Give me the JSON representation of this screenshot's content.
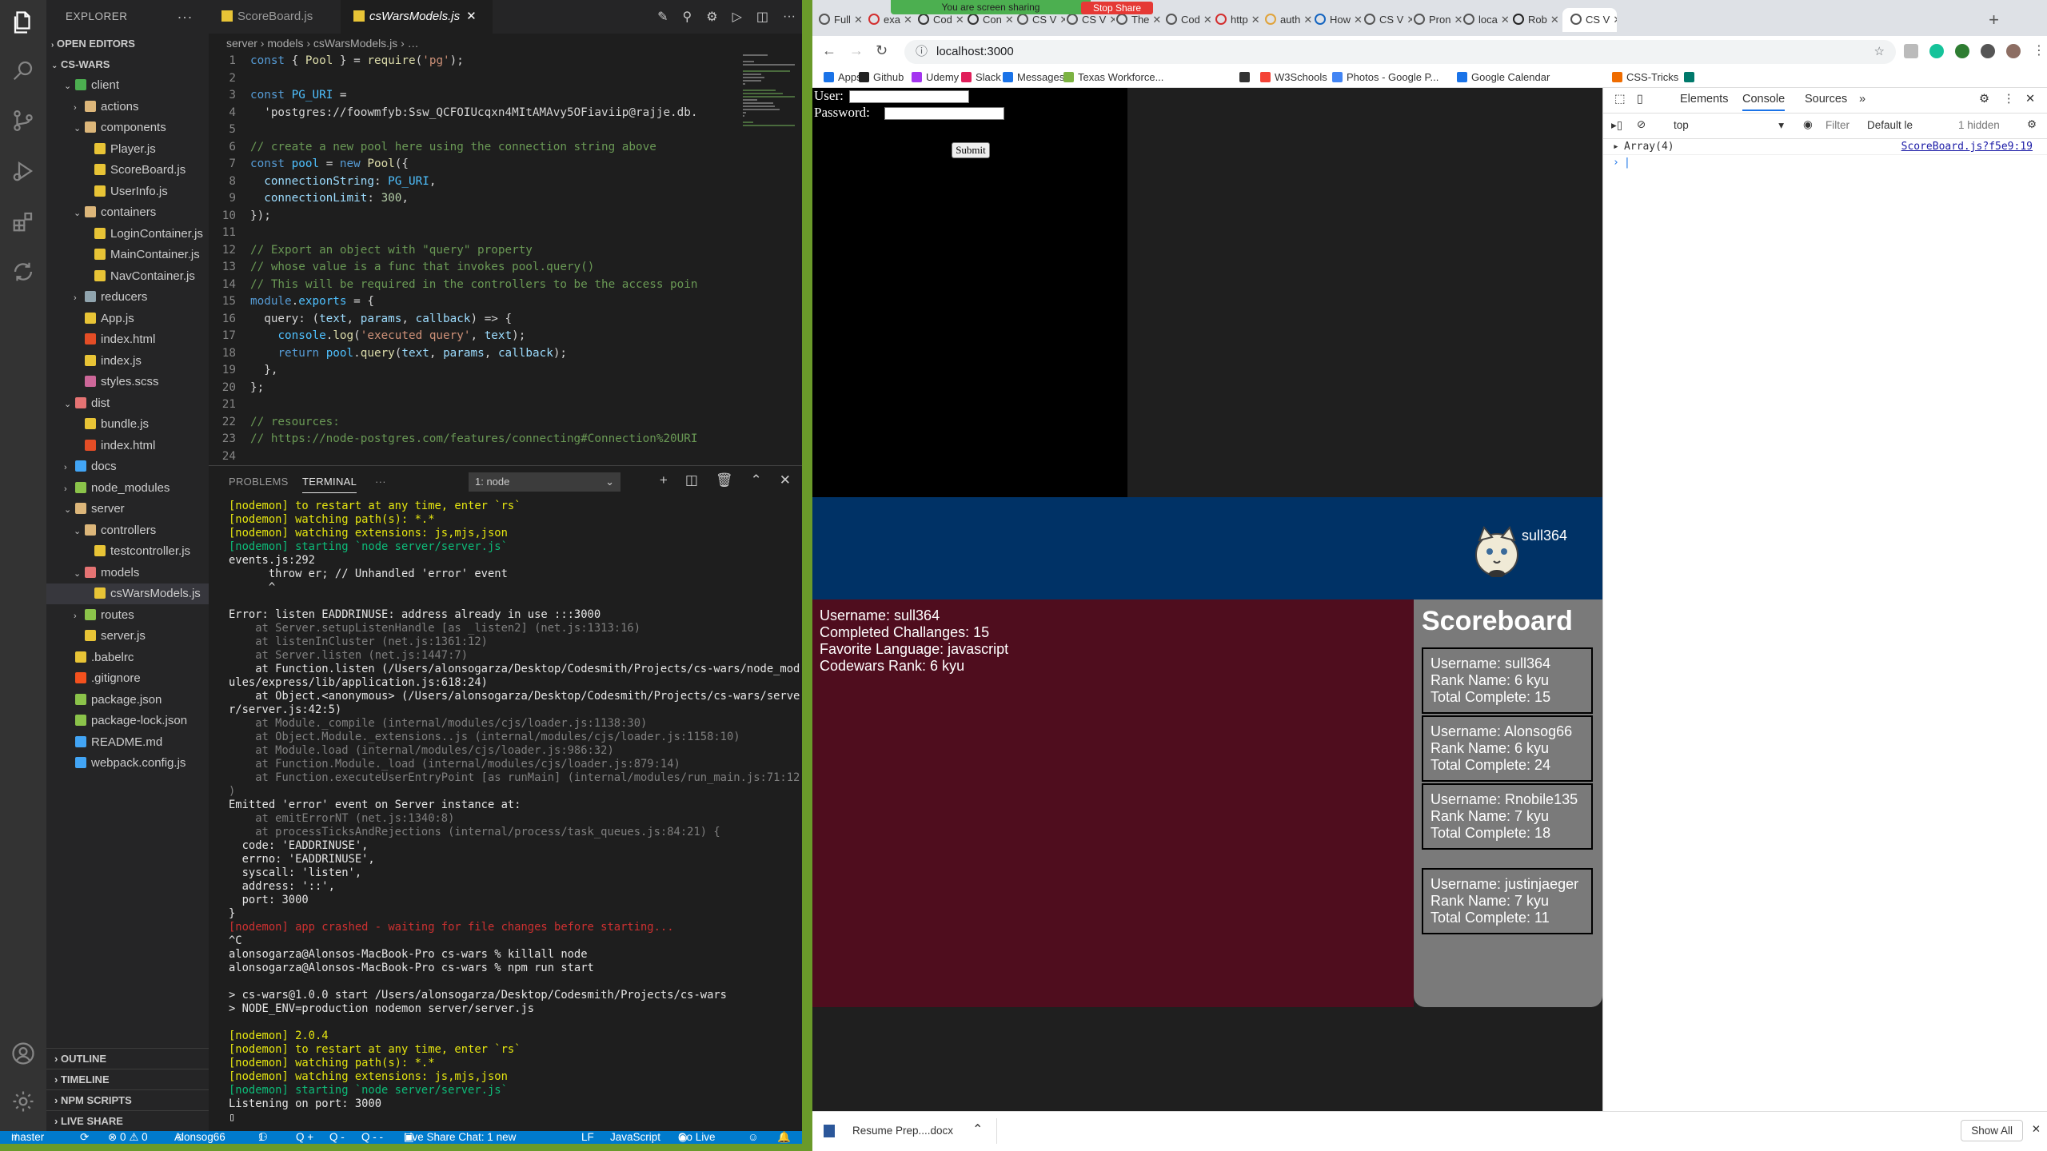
{
  "vscode": {
    "explorer_title": "EXPLORER",
    "open_editors": "OPEN EDITORS",
    "project": "CS-WARS",
    "tree": [
      {
        "label": "client",
        "depth": 1,
        "kind": "folder-open",
        "color": "#4caf50"
      },
      {
        "label": "actions",
        "depth": 2,
        "kind": "folder",
        "color": "#dcb67a"
      },
      {
        "label": "components",
        "depth": 2,
        "kind": "folder-open",
        "color": "#dcb67a"
      },
      {
        "label": "Player.js",
        "depth": 3,
        "kind": "js",
        "color": "#e8c436"
      },
      {
        "label": "ScoreBoard.js",
        "depth": 3,
        "kind": "js",
        "color": "#e8c436"
      },
      {
        "label": "UserInfo.js",
        "depth": 3,
        "kind": "js",
        "color": "#e8c436"
      },
      {
        "label": "containers",
        "depth": 2,
        "kind": "folder-open",
        "color": "#dcb67a"
      },
      {
        "label": "LoginContainer.js",
        "depth": 3,
        "kind": "js",
        "color": "#e8c436"
      },
      {
        "label": "MainContainer.js",
        "depth": 3,
        "kind": "js",
        "color": "#e8c436"
      },
      {
        "label": "NavContainer.js",
        "depth": 3,
        "kind": "js",
        "color": "#e8c436"
      },
      {
        "label": "reducers",
        "depth": 2,
        "kind": "folder",
        "color": "#90a4ae"
      },
      {
        "label": "App.js",
        "depth": 2,
        "kind": "js",
        "color": "#e8c436"
      },
      {
        "label": "index.html",
        "depth": 2,
        "kind": "html",
        "color": "#e44d26"
      },
      {
        "label": "index.js",
        "depth": 2,
        "kind": "js",
        "color": "#e8c436"
      },
      {
        "label": "styles.scss",
        "depth": 2,
        "kind": "scss",
        "color": "#cd6799"
      },
      {
        "label": "dist",
        "depth": 1,
        "kind": "folder-open",
        "color": "#e57373"
      },
      {
        "label": "bundle.js",
        "depth": 2,
        "kind": "js",
        "color": "#e8c436"
      },
      {
        "label": "index.html",
        "depth": 2,
        "kind": "html",
        "color": "#e44d26"
      },
      {
        "label": "docs",
        "depth": 1,
        "kind": "folder",
        "color": "#42a5f5"
      },
      {
        "label": "node_modules",
        "depth": 1,
        "kind": "folder",
        "color": "#8bc34a"
      },
      {
        "label": "server",
        "depth": 1,
        "kind": "folder-open",
        "color": "#dcb67a"
      },
      {
        "label": "controllers",
        "depth": 2,
        "kind": "folder-open",
        "color": "#dcb67a"
      },
      {
        "label": "testcontroller.js",
        "depth": 3,
        "kind": "js",
        "color": "#e8c436"
      },
      {
        "label": "models",
        "depth": 2,
        "kind": "folder-open",
        "color": "#e57373"
      },
      {
        "label": "csWarsModels.js",
        "depth": 3,
        "kind": "js",
        "color": "#e8c436",
        "selected": true
      },
      {
        "label": "routes",
        "depth": 2,
        "kind": "folder",
        "color": "#8bc34a"
      },
      {
        "label": "server.js",
        "depth": 2,
        "kind": "js",
        "color": "#e8c436"
      },
      {
        "label": ".babelrc",
        "depth": 1,
        "kind": "js",
        "color": "#e8c436"
      },
      {
        "label": ".gitignore",
        "depth": 1,
        "kind": "git",
        "color": "#f4511e"
      },
      {
        "label": "package.json",
        "depth": 1,
        "kind": "json",
        "color": "#8bc34a"
      },
      {
        "label": "package-lock.json",
        "depth": 1,
        "kind": "json",
        "color": "#8bc34a"
      },
      {
        "label": "README.md",
        "depth": 1,
        "kind": "info",
        "color": "#42a5f5"
      },
      {
        "label": "webpack.config.js",
        "depth": 1,
        "kind": "webpack",
        "color": "#42a5f5"
      }
    ],
    "bottom_sections": [
      "OUTLINE",
      "TIMELINE",
      "NPM SCRIPTS",
      "LIVE SHARE"
    ],
    "tabs": [
      {
        "label": "ScoreBoard.js",
        "active": false
      },
      {
        "label": "csWarsModels.js",
        "active": true
      }
    ],
    "breadcrumb": "server  ›  models  ›  csWarsModels.js  ›  …",
    "code": [
      "const { Pool } = require('pg');",
      "",
      "const PG_URI =",
      "  'postgres://foowmfyb:Ssw_QCFOIUcqxn4MItAMAvy5OFiaviip@rajje.db.",
      "",
      "// create a new pool here using the connection string above",
      "const pool = new Pool({",
      "  connectionString: PG_URI,",
      "  connectionLimit: 300,",
      "});",
      "",
      "// Export an object with \"query\" property",
      "// whose value is a func that invokes pool.query()",
      "// This will be required in the controllers to be the access poin",
      "module.exports = {",
      "  query: (text, params, callback) => {",
      "    console.log('executed query', text);",
      "    return pool.query(text, params, callback);",
      "  },",
      "};",
      "",
      "// resources:",
      "// https://node-postgres.com/features/connecting#Connection%20URI",
      ""
    ],
    "panel": {
      "problems": "PROBLEMS",
      "terminal": "TERMINAL",
      "more": "···",
      "terminal_select": "1: node"
    },
    "terminal": [
      {
        "t": "[nodemon] to restart at any time, enter `rs`",
        "c": "yel"
      },
      {
        "t": "[nodemon] watching path(s): *.*",
        "c": "yel"
      },
      {
        "t": "[nodemon] watching extensions: js,mjs,json",
        "c": "yel"
      },
      {
        "t": "[nodemon] starting `node server/server.js`",
        "c": "grn"
      },
      {
        "t": "events.js:292",
        "c": "wht"
      },
      {
        "t": "      throw er; // Unhandled 'error' event",
        "c": "wht"
      },
      {
        "t": "      ^",
        "c": "wht"
      },
      {
        "t": "",
        "c": "wht"
      },
      {
        "t": "Error: listen EADDRINUSE: address already in use :::3000",
        "c": "wht"
      },
      {
        "t": "    at Server.setupListenHandle [as _listen2] (net.js:1313:16)",
        "c": "gry"
      },
      {
        "t": "    at listenInCluster (net.js:1361:12)",
        "c": "gry"
      },
      {
        "t": "    at Server.listen (net.js:1447:7)",
        "c": "gry"
      },
      {
        "t": "    at Function.listen (/Users/alonsogarza/Desktop/Codesmith/Projects/cs-wars/node_mod",
        "c": "wht"
      },
      {
        "t": "ules/express/lib/application.js:618:24)",
        "c": "wht"
      },
      {
        "t": "    at Object.<anonymous> (/Users/alonsogarza/Desktop/Codesmith/Projects/cs-wars/serve",
        "c": "wht"
      },
      {
        "t": "r/server.js:42:5)",
        "c": "wht"
      },
      {
        "t": "    at Module._compile (internal/modules/cjs/loader.js:1138:30)",
        "c": "gry"
      },
      {
        "t": "    at Object.Module._extensions..js (internal/modules/cjs/loader.js:1158:10)",
        "c": "gry"
      },
      {
        "t": "    at Module.load (internal/modules/cjs/loader.js:986:32)",
        "c": "gry"
      },
      {
        "t": "    at Function.Module._load (internal/modules/cjs/loader.js:879:14)",
        "c": "gry"
      },
      {
        "t": "    at Function.executeUserEntryPoint [as runMain] (internal/modules/run_main.js:71:12",
        "c": "gry"
      },
      {
        "t": ")",
        "c": "gry"
      },
      {
        "t": "Emitted 'error' event on Server instance at:",
        "c": "wht"
      },
      {
        "t": "    at emitErrorNT (net.js:1340:8)",
        "c": "gry"
      },
      {
        "t": "    at processTicksAndRejections (internal/process/task_queues.js:84:21) {",
        "c": "gry"
      },
      {
        "t": "  code: 'EADDRINUSE',",
        "c": "wht"
      },
      {
        "t": "  errno: 'EADDRINUSE',",
        "c": "wht"
      },
      {
        "t": "  syscall: 'listen',",
        "c": "wht"
      },
      {
        "t": "  address: '::',",
        "c": "wht"
      },
      {
        "t": "  port: 3000",
        "c": "wht"
      },
      {
        "t": "}",
        "c": "wht"
      },
      {
        "t": "[nodemon] app crashed - waiting for file changes before starting...",
        "c": "red"
      },
      {
        "t": "^C",
        "c": "wht"
      },
      {
        "t": "alonsogarza@Alonsos-MacBook-Pro cs-wars % killall node",
        "c": "wht"
      },
      {
        "t": "alonsogarza@Alonsos-MacBook-Pro cs-wars % npm run start",
        "c": "wht"
      },
      {
        "t": "",
        "c": "wht"
      },
      {
        "t": "> cs-wars@1.0.0 start /Users/alonsogarza/Desktop/Codesmith/Projects/cs-wars",
        "c": "wht"
      },
      {
        "t": "> NODE_ENV=production nodemon server/server.js",
        "c": "wht"
      },
      {
        "t": "",
        "c": "wht"
      },
      {
        "t": "[nodemon] 2.0.4",
        "c": "yel"
      },
      {
        "t": "[nodemon] to restart at any time, enter `rs`",
        "c": "yel"
      },
      {
        "t": "[nodemon] watching path(s): *.*",
        "c": "yel"
      },
      {
        "t": "[nodemon] watching extensions: js,mjs,json",
        "c": "yel"
      },
      {
        "t": "[nodemon] starting `node server/server.js`",
        "c": "grn"
      },
      {
        "t": "Listening on port: 3000",
        "c": "wht"
      },
      {
        "t": "▯",
        "c": "wht"
      }
    ],
    "status": {
      "branch": "master",
      "problems": "⊗ 0 ⚠ 0",
      "user": "Alonsog66",
      "live": "1",
      "q1": "Q +",
      "q2": "Q -",
      "q3": "Q - -",
      "chat": "Live Share Chat: 1 new",
      "eol": "LF",
      "lang": "JavaScript",
      "golive": "Go Live"
    }
  },
  "chrome": {
    "sharing": "You are screen sharing",
    "stop_share": "Stop Share",
    "tabs": [
      "Full",
      "exa",
      "Cod",
      "Con",
      "CS V",
      "CS V",
      "The",
      "Cod",
      "http",
      "auth",
      "How",
      "CS V",
      "Pron",
      "loca",
      "Rob",
      "CS V"
    ],
    "url": "localhost:3000",
    "bookmarks": [
      "Apps",
      "Github",
      "Udemy",
      "Slack",
      "Messages",
      "Texas Workforce...",
      "W3Schools",
      "Photos - Google P...",
      "Google Calendar",
      "CSS-Tricks"
    ],
    "page": {
      "user_label": "User:",
      "password_label": "Password:",
      "submit": "Submit",
      "nav_user": "sull364",
      "info": {
        "username": "Username: sull364",
        "completed": "Completed Challanges: 15",
        "language": "Favorite Language: javascript",
        "rank": "Codewars Rank: 6 kyu"
      },
      "scoreboard_title": "Scoreboard",
      "scoreboard": [
        {
          "username": "Username: sull364",
          "rank": "Rank Name: 6 kyu",
          "total": "Total Complete: 15"
        },
        {
          "username": "Username: Alonsog66",
          "rank": "Rank Name: 6 kyu",
          "total": "Total Complete: 24"
        },
        {
          "username": "Username: Rnobile135",
          "rank": "Rank Name: 7 kyu",
          "total": "Total Complete: 18"
        },
        {
          "username": "Username: justinjaeger",
          "rank": "Rank Name: 7 kyu",
          "total": "Total Complete: 11"
        }
      ]
    },
    "devtools": {
      "tabs": [
        "Elements",
        "Console",
        "Sources",
        "»"
      ],
      "context": "top",
      "filter": "Filter",
      "levels": "Default le",
      "hidden": "1 hidden",
      "log_value": "Array(4)",
      "log_source": "ScoreBoard.js?f5e9:19"
    },
    "download_name": "Resume Prep....docx",
    "show_all": "Show All"
  }
}
